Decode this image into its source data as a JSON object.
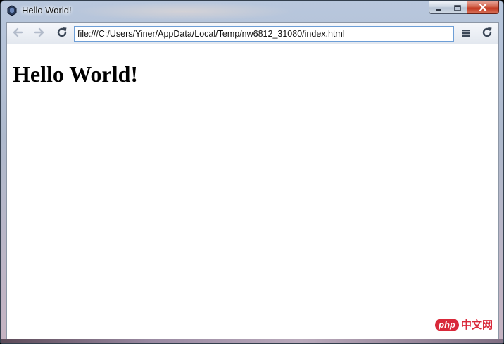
{
  "window": {
    "title": "Hello World!"
  },
  "controls": {
    "minimize": "minimize-icon",
    "maximize": "maximize-icon",
    "close": "close-icon"
  },
  "toolbar": {
    "back_icon": "arrow-left-icon",
    "forward_icon": "arrow-right-icon",
    "reload_icon": "reload-icon",
    "url": "file:///C:/Users/Yiner/AppData/Local/Temp/nw6812_31080/index.html",
    "menu_icon": "hamburger-menu-icon"
  },
  "page": {
    "heading": "Hello World!"
  },
  "watermark": {
    "brand": "php",
    "site": "中文网"
  },
  "colors": {
    "accent": "#6d9ed6",
    "close": "#c2361e",
    "watermark": "#d9293a"
  }
}
